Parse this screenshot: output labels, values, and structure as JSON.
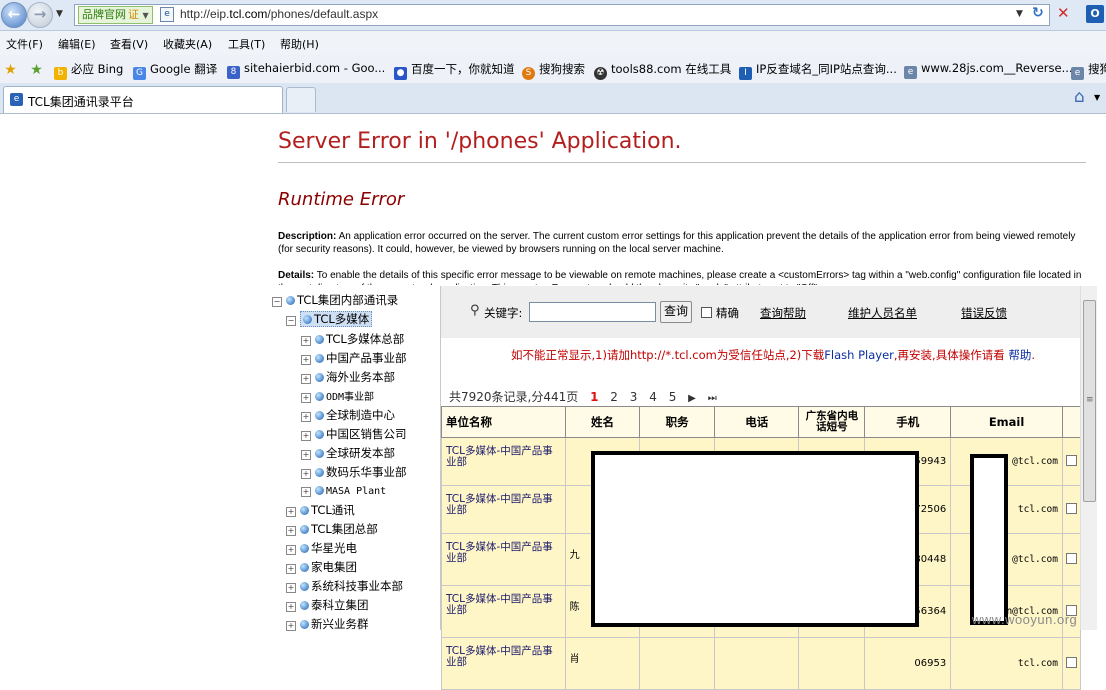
{
  "browser": {
    "brand_badge": "品牌官网",
    "brand_badge_mark": "证",
    "url_prefix": "http://eip.",
    "url_domain": "tcl.com",
    "url_path": "/phones/default.aspx",
    "menu": [
      "文件(F)",
      "编辑(E)",
      "查看(V)",
      "收藏夹(A)",
      "工具(T)",
      "帮助(H)"
    ],
    "favorites": [
      "必应 Bing",
      "Google 翻译",
      "sitehaierbid.com - Goo...",
      "百度一下，你就知道",
      "搜狗搜索",
      "tools88.com 在线工具",
      "IP反查域名_同IP站点查询...",
      "www.28js.com__Reverse...",
      "搜狗"
    ],
    "tab_title": "TCL集团通讯录平台"
  },
  "error_page": {
    "title": "Server Error in '/phones' Application.",
    "subtitle": "Runtime Error",
    "description_label": "Description:",
    "description_text": " An application error occurred on the server. The current custom error settings for this application prevent the details of the application error from being viewed remotely (for security reasons). It could, however, be viewed by browsers running on the local server machine.",
    "details_label": "Details:",
    "details_text": " To enable the details of this specific error message to be viewable on remote machines, please create a <customErrors> tag within a \"web.config\" configuration file located in the root directory of the current web application. This <customErrors> tag should then have its \"mode\" attribute set to \"Off\"."
  },
  "tree": {
    "root": "TCL集团内部通讯录",
    "selected": "TCL多媒体",
    "children": [
      "TCL多媒体总部",
      "中国产品事业部",
      "海外业务本部",
      "ODM事业部",
      "全球制造中心",
      "中国区销售公司",
      "全球研发本部",
      "数码乐华事业部",
      "MASA Plant"
    ],
    "siblings": [
      "TCL通讯",
      "TCL集团总部",
      "华星光电",
      "家电集团",
      "系统科技事业本部",
      "泰科立集团",
      "新兴业务群"
    ]
  },
  "search": {
    "keyword_label": "关键字",
    "query_button": "查询",
    "exact_label": "精确",
    "links": [
      "查询帮助",
      "维护人员名单",
      "错误反馈"
    ]
  },
  "notice": {
    "text_before": "如不能正常显示,1)请加http://*.tcl.com为受信任站点,2)下载",
    "flash": "Flash Player",
    "text_after": ",再安装,具体操作请看 ",
    "help": "帮助",
    "end": "."
  },
  "pager": {
    "summary": "共7920条记录,分441页",
    "pages": [
      "1",
      "2",
      "3",
      "4",
      "5"
    ],
    "next": "▶",
    "last": "⏭"
  },
  "table": {
    "headers": [
      "单位名称",
      "姓名",
      "职务",
      "电话",
      "广东省内电话短号",
      "手机",
      "Email"
    ],
    "rows": [
      {
        "unit": "TCL多媒体-中国产品事业部",
        "name": "",
        "mobile": "59943",
        "email": "@tcl.com"
      },
      {
        "unit": "TCL多媒体-中国产品事业部",
        "name": "",
        "mobile": "72506",
        "email": "tcl.com"
      },
      {
        "unit": "TCL多媒体-中国产品事业部",
        "name": "九",
        "mobile": "80448",
        "email": "@tcl.com"
      },
      {
        "unit": "TCL多媒体-中国产品事业部",
        "name": "陈",
        "mobile": "56364",
        "email": "f    n@tcl.com"
      },
      {
        "unit": "TCL多媒体-中国产品事业部",
        "name": "肖",
        "mobile": "06953",
        "email": "tcl.com"
      }
    ]
  },
  "watermark": "www.wooyun.org"
}
